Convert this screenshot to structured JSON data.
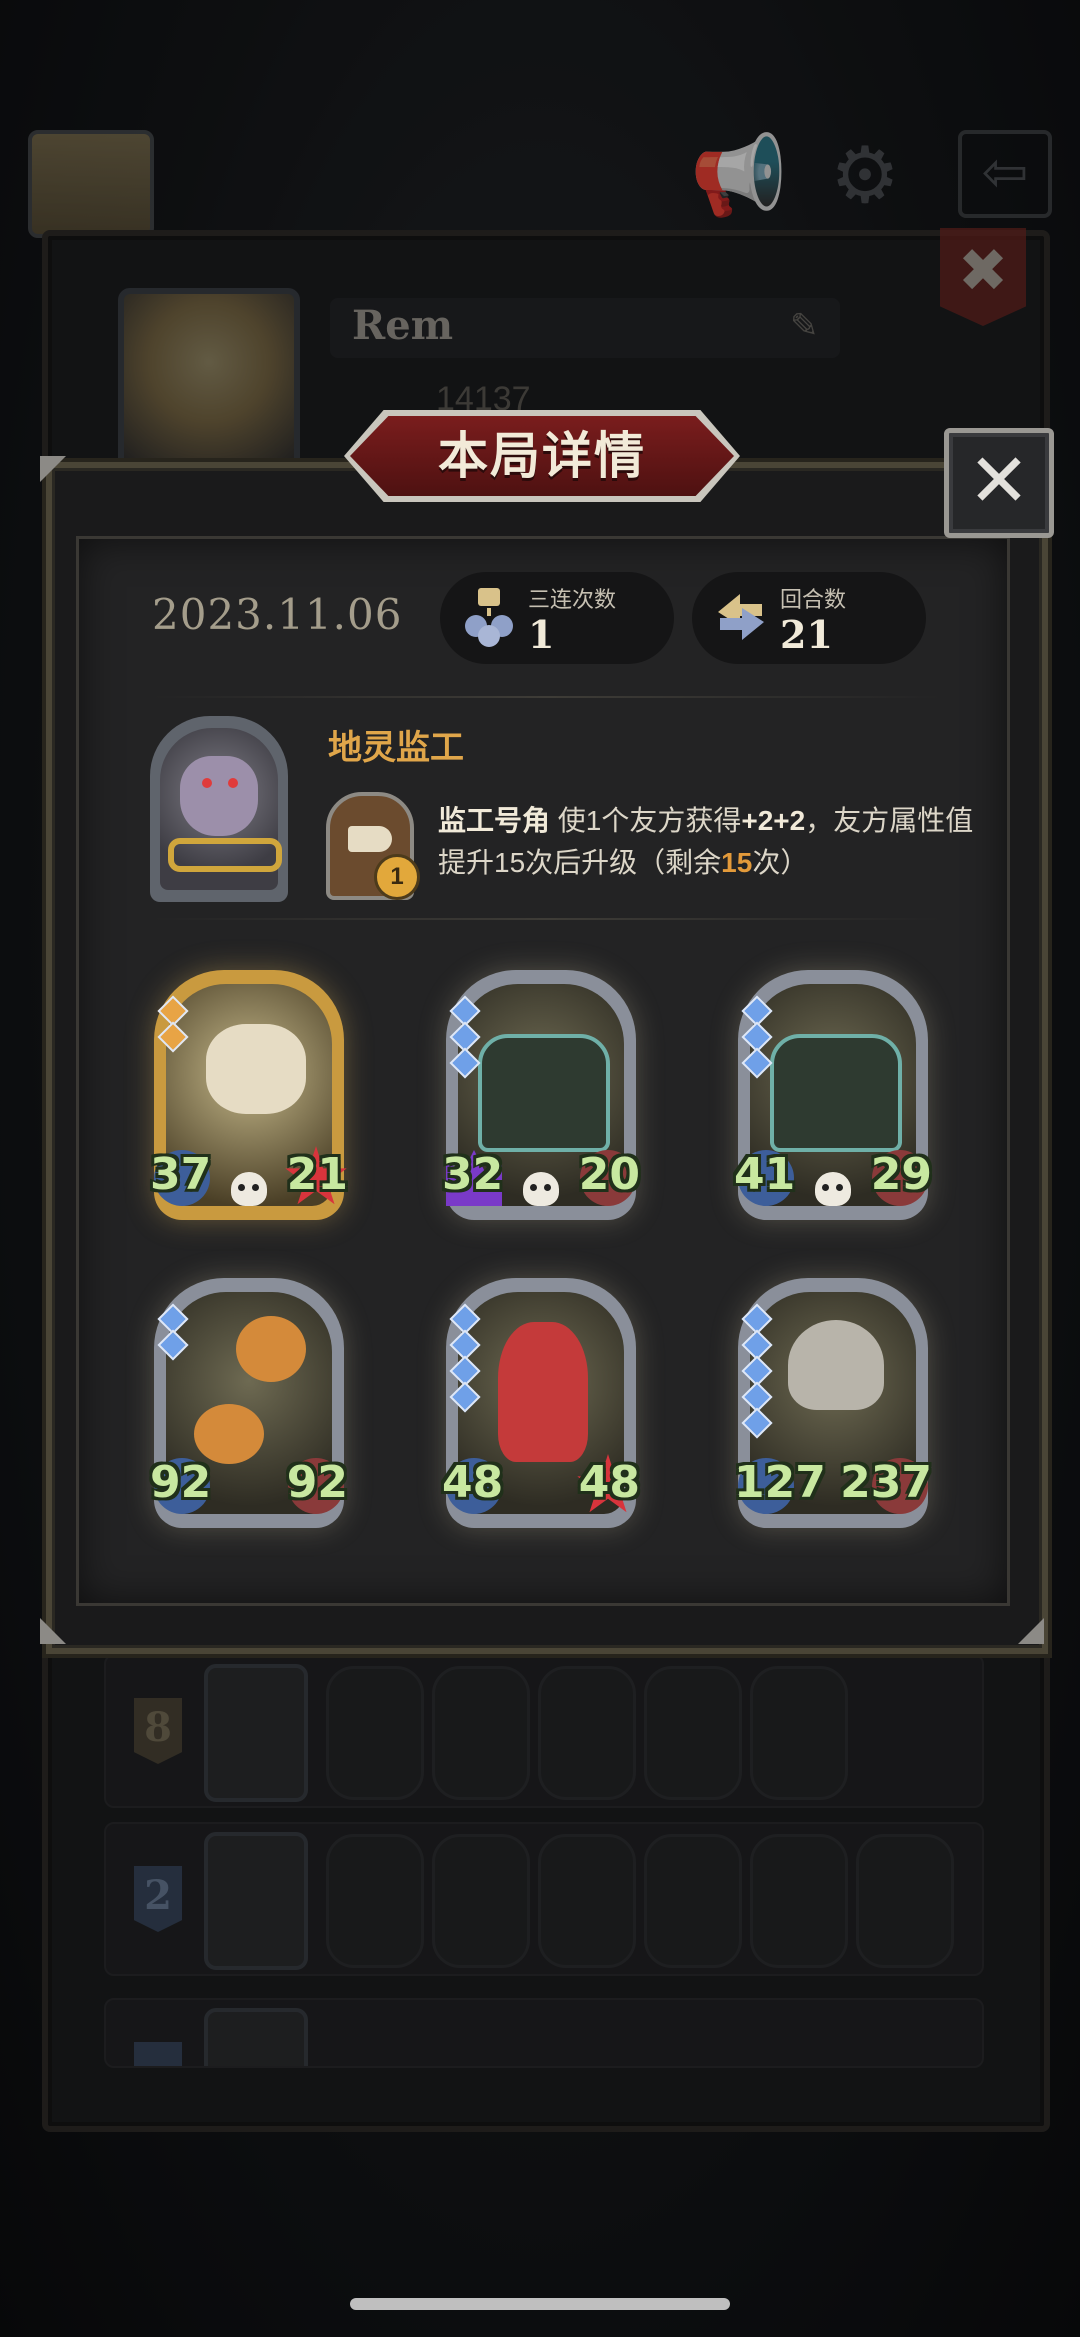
{
  "background": {
    "player_name": "Rem",
    "player_score": "14137",
    "rows": [
      {
        "rank": "8",
        "units": 6
      },
      {
        "rank": "2",
        "units": 6
      },
      {
        "rank": "",
        "units": 6
      }
    ]
  },
  "modal": {
    "title": "本局详情",
    "close_glyph": "✕",
    "date": "2023.11.06",
    "stats": [
      {
        "label": "三连次数",
        "value": "1",
        "icon": "triple-merge-icon"
      },
      {
        "label": "回合数",
        "value": "21",
        "icon": "rounds-cycle-icon"
      }
    ],
    "hero": {
      "name": "地灵监工",
      "skill_level": "1",
      "skill_name": "监工号角",
      "skill_text_a": " 使1个友方获得",
      "skill_bonus": "+2+2",
      "skill_text_b": "，友方属性值提升15次后升级（剩余",
      "skill_remaining": "15",
      "skill_text_c": "次）"
    },
    "units": [
      {
        "atk": "37",
        "hp": "21",
        "rarity": "gold",
        "creature": "bone-dragon",
        "hp_style": "star",
        "skull": true
      },
      {
        "atk": "32",
        "hp": "20",
        "rarity": "silver",
        "creature": "mimic-chest",
        "atk_style": "purple",
        "skull": true
      },
      {
        "atk": "41",
        "hp": "29",
        "rarity": "silver",
        "creature": "mimic-chest",
        "skull": true
      },
      {
        "atk": "92",
        "hp": "92",
        "rarity": "silver",
        "creature": "pumpkin-ghost"
      },
      {
        "atk": "48",
        "hp": "48",
        "rarity": "silver",
        "creature": "clown",
        "hp_style": "star"
      },
      {
        "atk": "127",
        "hp": "237",
        "rarity": "silver",
        "creature": "hooded-knight"
      }
    ]
  },
  "colors": {
    "accent_gold": "#e0a64a",
    "highlight_orange": "#e39a3a",
    "banner_red": "#7a1d1d",
    "stat_green": "#c8e8a0"
  }
}
